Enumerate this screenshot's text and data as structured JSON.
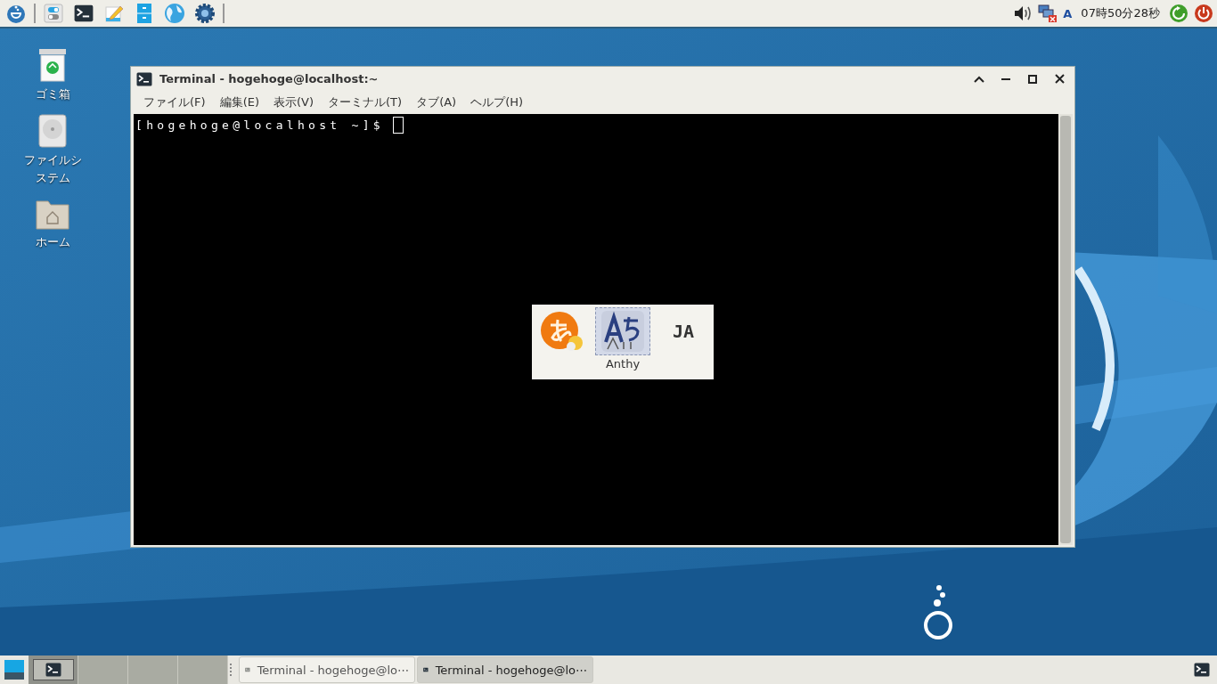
{
  "top_panel": {
    "keyboard_indicator": "A",
    "clock": "07時50分28秒"
  },
  "desktop_icons": [
    {
      "kind": "trash",
      "label": "ゴミ箱"
    },
    {
      "kind": "drive",
      "label": "ファイルシステム"
    },
    {
      "kind": "home",
      "label": "ホーム"
    }
  ],
  "window": {
    "title": "Terminal - hogehoge@localhost:~",
    "menu": [
      "ファイル(F)",
      "編集(E)",
      "表示(V)",
      "ターミナル(T)",
      "タブ(A)",
      "ヘルプ(H)"
    ],
    "prompt": "[hogehoge@localhost ~]$"
  },
  "input_method_popup": {
    "items": [
      {
        "kind": "hiragana",
        "selected": false
      },
      {
        "kind": "anthy",
        "selected": true
      },
      {
        "kind": "text",
        "text": "JA",
        "selected": false
      }
    ],
    "caption": "Anthy"
  },
  "taskbar": {
    "workspaces": [
      {
        "selected": true
      },
      {
        "selected": false
      },
      {
        "selected": false
      },
      {
        "selected": false
      }
    ],
    "tasks": [
      {
        "title": "Terminal - hogehoge@lo⋯",
        "selected": false
      },
      {
        "title": "Terminal - hogehoge@lo⋯",
        "selected": true
      }
    ]
  }
}
